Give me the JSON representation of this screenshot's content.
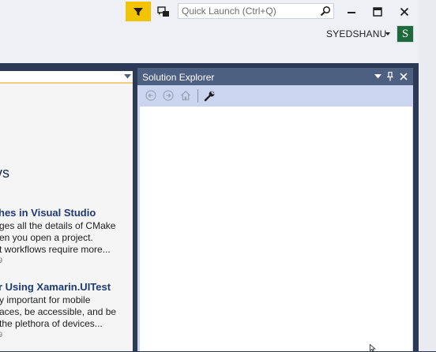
{
  "titlebar": {
    "quick_launch_placeholder": "Quick Launch (Ctrl+Q)",
    "user_name": "SYEDSHANU",
    "avatar_letter": "S",
    "accent_color": "#f2c400"
  },
  "left_panel": {
    "news_heading": "vs",
    "articles": [
      {
        "title": "hes in Visual Studio",
        "lines": [
          "ges all the details of CMake",
          "en you open a project.",
          "t workflows require more..."
        ],
        "date": "9"
      },
      {
        "title": "r Using Xamarin.UITest",
        "lines": [
          "y important for mobile",
          "aces, be accessible, and be",
          "the plethora of devices..."
        ],
        "date": "9"
      }
    ]
  },
  "solution_explorer": {
    "title": "Solution Explorer",
    "toolbar_icons": [
      "back-icon",
      "forward-icon",
      "home-icon",
      "wrench-icon"
    ]
  }
}
